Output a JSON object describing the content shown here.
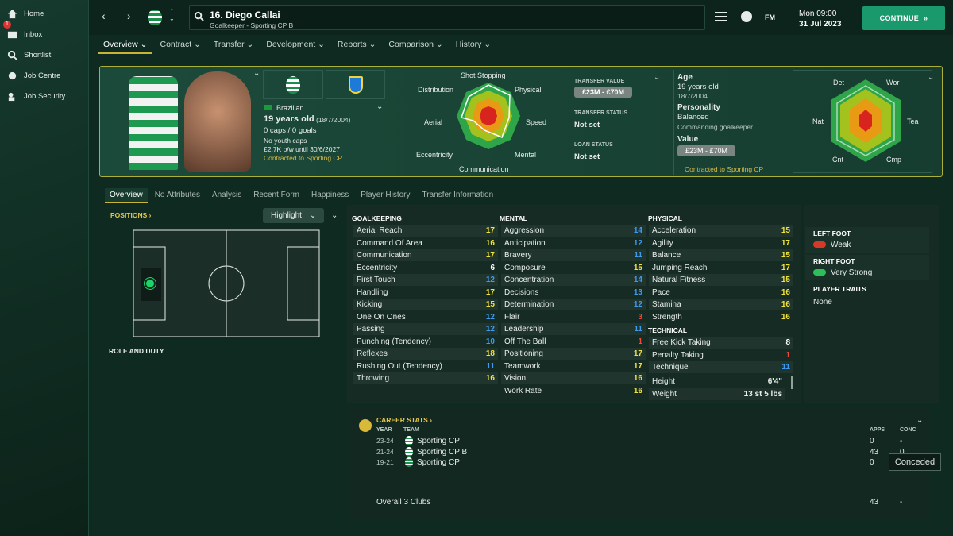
{
  "sidebar": {
    "items": [
      {
        "label": "Home",
        "icon": "home-icon"
      },
      {
        "label": "Inbox",
        "icon": "inbox-icon",
        "badge": "1"
      },
      {
        "label": "Shortlist",
        "icon": "search-icon"
      },
      {
        "label": "Job Centre",
        "icon": "job-centre-icon"
      },
      {
        "label": "Job Security",
        "icon": "job-security-icon"
      }
    ]
  },
  "header": {
    "player_name": "16. Diego Callai",
    "player_sub": "Goalkeeper - Sporting CP B",
    "fm_label": "FM",
    "day_time": "Mon 09:00",
    "date": "31 Jul 2023",
    "continue_label": "CONTINUE"
  },
  "tabs": [
    "Overview",
    "Contract",
    "Transfer",
    "Development",
    "Reports",
    "Comparison",
    "History"
  ],
  "profile": {
    "nationality": "Brazilian",
    "age_line": "19 years old",
    "dob": "(18/7/2004)",
    "caps": "0 caps / 0 goals",
    "youth_caps": "No youth caps",
    "wage": "£2.7K p/w until 30/6/2027",
    "contract": "Contracted to Sporting CP"
  },
  "radar_left": {
    "labels": [
      "Shot Stopping",
      "Physical",
      "Speed",
      "Mental",
      "Communication",
      "Eccentricity",
      "Aerial",
      "Distribution"
    ]
  },
  "transfer": {
    "value_label": "TRANSFER VALUE",
    "value": "£23M - £70M",
    "status_label": "TRANSFER STATUS",
    "status": "Not set",
    "loan_label": "LOAN STATUS",
    "loan": "Not set"
  },
  "info": {
    "age_label": "Age",
    "age": "19 years old",
    "dob": "18/7/2004",
    "personality_label": "Personality",
    "personality": "Balanced",
    "role_desc": "Commanding goalkeeper",
    "value_label": "Value",
    "value": "£23M - £70M",
    "contract": "Contracted to Sporting CP"
  },
  "radar_right": {
    "labels": [
      "Det",
      "Wor",
      "Tea",
      "Cmp",
      "Cnt",
      "Nat"
    ]
  },
  "subtabs": [
    "Overview",
    "No Attributes",
    "Analysis",
    "Recent Form",
    "Happiness",
    "Player History",
    "Transfer Information"
  ],
  "positions": {
    "label": "POSITIONS",
    "highlight": "Highlight",
    "role_duty": "ROLE AND DUTY"
  },
  "goalkeeping": {
    "title": "GOALKEEPING",
    "rows": [
      [
        "Aerial Reach",
        "17",
        "yellow"
      ],
      [
        "Command Of Area",
        "16",
        "yellow"
      ],
      [
        "Communication",
        "17",
        "yellow"
      ],
      [
        "Eccentricity",
        "6",
        "white"
      ],
      [
        "First Touch",
        "12",
        "blue"
      ],
      [
        "Handling",
        "17",
        "yellow"
      ],
      [
        "Kicking",
        "15",
        "yellow"
      ],
      [
        "One On Ones",
        "12",
        "blue"
      ],
      [
        "Passing",
        "12",
        "blue"
      ],
      [
        "Punching (Tendency)",
        "10",
        "blue"
      ],
      [
        "Reflexes",
        "18",
        "yellow"
      ],
      [
        "Rushing Out (Tendency)",
        "11",
        "blue"
      ],
      [
        "Throwing",
        "16",
        "yellow"
      ]
    ]
  },
  "mental": {
    "title": "MENTAL",
    "rows": [
      [
        "Aggression",
        "14",
        "blue"
      ],
      [
        "Anticipation",
        "12",
        "blue"
      ],
      [
        "Bravery",
        "11",
        "blue"
      ],
      [
        "Composure",
        "15",
        "yellow"
      ],
      [
        "Concentration",
        "14",
        "blue"
      ],
      [
        "Decisions",
        "13",
        "blue"
      ],
      [
        "Determination",
        "12",
        "blue"
      ],
      [
        "Flair",
        "3",
        "red"
      ],
      [
        "Leadership",
        "11",
        "blue"
      ],
      [
        "Off The Ball",
        "1",
        "red"
      ],
      [
        "Positioning",
        "17",
        "yellow"
      ],
      [
        "Teamwork",
        "17",
        "yellow"
      ],
      [
        "Vision",
        "16",
        "yellow"
      ],
      [
        "Work Rate",
        "16",
        "yellow"
      ]
    ]
  },
  "physical": {
    "title": "PHYSICAL",
    "rows": [
      [
        "Acceleration",
        "15",
        "yellow"
      ],
      [
        "Agility",
        "17",
        "yellow"
      ],
      [
        "Balance",
        "15",
        "yellow"
      ],
      [
        "Jumping Reach",
        "17",
        "yellow"
      ],
      [
        "Natural Fitness",
        "15",
        "yellow"
      ],
      [
        "Pace",
        "16",
        "yellow"
      ],
      [
        "Stamina",
        "16",
        "yellow"
      ],
      [
        "Strength",
        "16",
        "yellow"
      ]
    ]
  },
  "technical": {
    "title": "TECHNICAL",
    "rows": [
      [
        "Free Kick Taking",
        "8",
        "white"
      ],
      [
        "Penalty Taking",
        "1",
        "red"
      ],
      [
        "Technique",
        "11",
        "blue"
      ]
    ]
  },
  "measures": {
    "height_label": "Height",
    "height": "6'4\"",
    "weight_label": "Weight",
    "weight": "13 st 5 lbs"
  },
  "feet": {
    "left_label": "LEFT FOOT",
    "left": "Weak",
    "right_label": "RIGHT FOOT",
    "right": "Very Strong",
    "traits_label": "PLAYER TRAITS",
    "traits": "None"
  },
  "career": {
    "title": "CAREER STATS",
    "col_year": "YEAR",
    "col_team": "TEAM",
    "col_apps": "APPS",
    "col_conc": "CONC",
    "rows": [
      [
        "23-24",
        "Sporting CP",
        "0",
        "-"
      ],
      [
        "21-24",
        "Sporting CP B",
        "43",
        "0"
      ],
      [
        "19-21",
        "Sporting CP",
        "0",
        ""
      ]
    ],
    "overall": "Overall 3 Clubs",
    "overall_apps": "43",
    "overall_conc": "-"
  },
  "tooltip": "Conceded"
}
